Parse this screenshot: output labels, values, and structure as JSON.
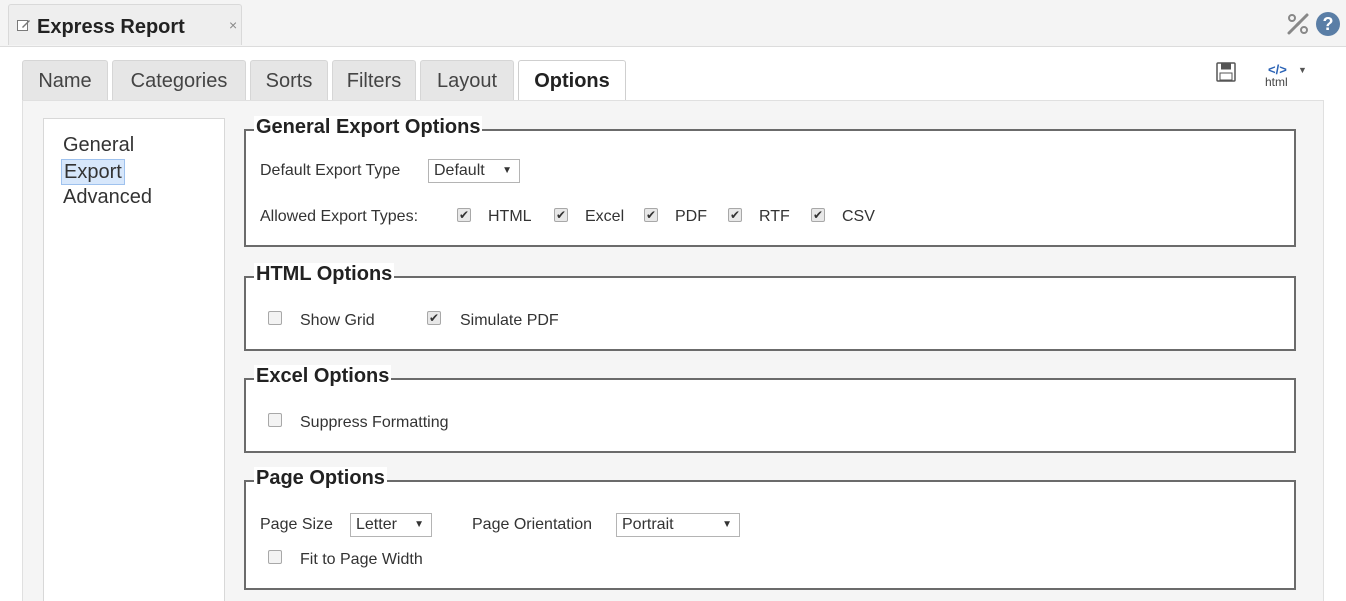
{
  "window": {
    "title": "Express Report",
    "close_glyph": "×"
  },
  "icons": {
    "edit": "edit-icon",
    "tools": "tools-icon",
    "help": "help-icon",
    "save": "save-icon",
    "html_export": "html-export-icon"
  },
  "toolbar": {
    "html_code": "</>",
    "html_label": "html",
    "help_glyph": "?"
  },
  "tabs": [
    {
      "label": "Name",
      "active": false
    },
    {
      "label": "Categories",
      "active": false
    },
    {
      "label": "Sorts",
      "active": false
    },
    {
      "label": "Filters",
      "active": false
    },
    {
      "label": "Layout",
      "active": false
    },
    {
      "label": "Options",
      "active": true
    }
  ],
  "leftnav": [
    {
      "label": "General",
      "selected": false
    },
    {
      "label": "Export",
      "selected": true
    },
    {
      "label": "Advanced",
      "selected": false
    }
  ],
  "general_export": {
    "legend": "General Export Options",
    "default_type_label": "Default Export Type",
    "default_type_value": "Default",
    "allowed_label": "Allowed Export Types:",
    "types": [
      {
        "label": "HTML",
        "checked": true
      },
      {
        "label": "Excel",
        "checked": true
      },
      {
        "label": "PDF",
        "checked": true
      },
      {
        "label": "RTF",
        "checked": true
      },
      {
        "label": "CSV",
        "checked": true
      }
    ]
  },
  "html_options": {
    "legend": "HTML Options",
    "show_grid": {
      "label": "Show Grid",
      "checked": false
    },
    "simulate_pdf": {
      "label": "Simulate PDF",
      "checked": true
    }
  },
  "excel_options": {
    "legend": "Excel Options",
    "suppress": {
      "label": "Suppress Formatting",
      "checked": false
    }
  },
  "page_options": {
    "legend": "Page Options",
    "size_label": "Page Size",
    "size_value": "Letter",
    "orientation_label": "Page Orientation",
    "orientation_value": "Portrait",
    "fit": {
      "label": "Fit to Page Width",
      "checked": false
    }
  },
  "glyphs": {
    "check": "✔",
    "dropdown": "▼"
  },
  "colors": {
    "nav_selected_bg": "#d7e7fb",
    "help_icon": "#5a7ea6",
    "html_icon": "#2a62b5"
  }
}
